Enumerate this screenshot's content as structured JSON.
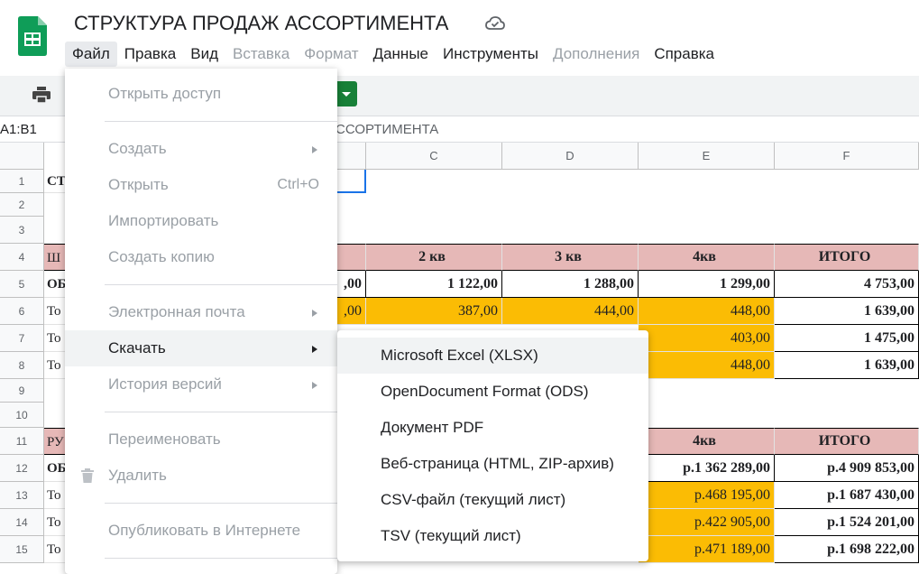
{
  "header": {
    "title": "СТРУКТУРА ПРОДАЖ АССОРТИМЕНТА",
    "icons": {
      "logo": "sheets-logo",
      "cloud": "cloud-saved-icon"
    }
  },
  "menubar": [
    {
      "label": "Файл",
      "state": "active"
    },
    {
      "label": "Правка",
      "state": "enabled"
    },
    {
      "label": "Вид",
      "state": "enabled"
    },
    {
      "label": "Вставка",
      "state": "disabled"
    },
    {
      "label": "Формат",
      "state": "disabled"
    },
    {
      "label": "Данные",
      "state": "enabled"
    },
    {
      "label": "Инструменты",
      "state": "enabled"
    },
    {
      "label": "Дополнения",
      "state": "disabled"
    },
    {
      "label": "Справка",
      "state": "enabled"
    }
  ],
  "formula_bar": {
    "name_box": "A1:B1",
    "content": "ССОРТИМЕНТА"
  },
  "columns": [
    "C",
    "D",
    "E",
    "F"
  ],
  "rows": [
    "1",
    "2",
    "3",
    "4",
    "5",
    "6",
    "7",
    "8",
    "9",
    "10",
    "11",
    "12",
    "13",
    "14",
    "15"
  ],
  "row_starts": {
    "1": "СТ",
    "4": "Ш",
    "5": "ОБ",
    "6": "То",
    "7": "То",
    "8": "То",
    "11": "РУ",
    "12": "ОБ",
    "13": "То",
    "14": "То",
    "15": "То"
  },
  "table1": {
    "headers": {
      "C": "2 кв",
      "D": "3 кв",
      "E": "4кв",
      "F": "ИТОГО"
    },
    "total_row": {
      "B_partial": ",00",
      "C": "1 122,00",
      "D": "1 288,00",
      "E": "1 299,00",
      "F": "4 753,00"
    },
    "row6": {
      "B_partial": ",00",
      "C": "387,00",
      "D": "444,00",
      "E": "448,00",
      "F": "1 639,00"
    },
    "row7": {
      "E": "403,00",
      "F": "1 475,00"
    },
    "row8": {
      "E": "448,00",
      "F": "1 639,00"
    }
  },
  "table2": {
    "headers": {
      "E": "4кв",
      "F": "ИТОГО"
    },
    "total_row": {
      "E": "р.1 362 289,00",
      "F": "р.4 909 853,00"
    },
    "row13": {
      "E": "р.468 195,00",
      "F": "р.1 687 430,00"
    },
    "row14": {
      "E": "р.422 905,00",
      "F": "р.1 524 201,00"
    },
    "row15": {
      "E": "р.471 189,00",
      "F": "р.1 698 222,00"
    }
  },
  "file_menu": {
    "items": [
      {
        "label": "Открыть доступ",
        "enabled": false
      },
      {
        "label": "Создать",
        "enabled": false,
        "submenu": true
      },
      {
        "label": "Открыть",
        "enabled": false,
        "shortcut": "Ctrl+O"
      },
      {
        "label": "Импортировать",
        "enabled": false
      },
      {
        "label": "Создать копию",
        "enabled": false
      },
      {
        "label": "Электронная почта",
        "enabled": false,
        "submenu": true
      },
      {
        "label": "Скачать",
        "enabled": true,
        "submenu": true,
        "highlighted": true
      },
      {
        "label": "История версий",
        "enabled": false,
        "submenu": true
      },
      {
        "label": "Переименовать",
        "enabled": false
      },
      {
        "label": "Удалить",
        "enabled": false,
        "icon": "trash-icon"
      },
      {
        "label": "Опубликовать в Интернете",
        "enabled": false
      }
    ]
  },
  "download_submenu": {
    "items": [
      {
        "label": "Microsoft Excel (XLSX)",
        "highlighted": true
      },
      {
        "label": "OpenDocument Format (ODS)"
      },
      {
        "label": "Документ PDF"
      },
      {
        "label": "Веб-страница (HTML, ZIP-архив)"
      },
      {
        "label": "CSV-файл (текущий лист)"
      },
      {
        "label": "TSV (текущий лист)"
      }
    ]
  },
  "colors": {
    "header_fill": "#e6b8b7",
    "highlight_fill": "#fbbc04",
    "sheets_green": "#188038"
  }
}
